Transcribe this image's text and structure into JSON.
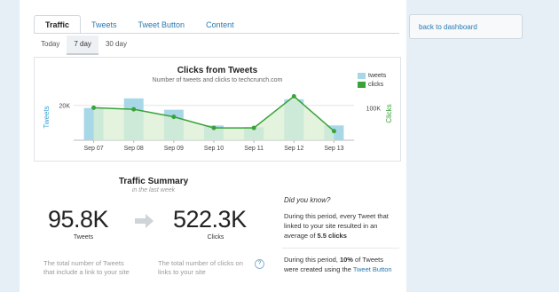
{
  "tabs": [
    {
      "label": "Traffic",
      "active": true
    },
    {
      "label": "Tweets",
      "active": false
    },
    {
      "label": "Tweet Button",
      "active": false
    },
    {
      "label": "Content",
      "active": false
    }
  ],
  "range_tabs": [
    {
      "label": "Today",
      "active": false
    },
    {
      "label": "7 day",
      "active": true
    },
    {
      "label": "30 day",
      "active": false
    }
  ],
  "back_button": "back to dashboard",
  "chart_data": {
    "type": "bar",
    "title": "Clicks from Tweets",
    "subtitle": "Number of tweets and clicks to techcrunch.com",
    "categories": [
      "Sep 07",
      "Sep 08",
      "Sep 09",
      "Sep 10",
      "Sep 11",
      "Sep 12",
      "Sep 13"
    ],
    "series": [
      {
        "name": "tweets",
        "type": "bar",
        "values": [
          18500,
          24000,
          17500,
          8500,
          7500,
          23500,
          8500
        ],
        "color": "#a8d8e8"
      },
      {
        "name": "clicks",
        "type": "area",
        "values": [
          100000,
          95000,
          72000,
          38000,
          38000,
          135000,
          28000
        ],
        "color": "#3aa23a"
      }
    ],
    "ylabel_left": "Tweets",
    "ylabel_right": "Clicks",
    "yticks_left": [
      "20K"
    ],
    "yticks_right": [
      "100K"
    ],
    "ylim_left": [
      0,
      28000
    ],
    "ylim_right": [
      0,
      150000
    ],
    "legend_position": "top-right"
  },
  "summary": {
    "title": "Traffic Summary",
    "subtitle": "in the last week",
    "tweets_value": "95.8K",
    "tweets_label": "Tweets",
    "clicks_value": "522.3K",
    "clicks_label": "Clicks",
    "tweets_desc_1": "The total number of Tweets",
    "tweets_desc_2": "that include a link to your site",
    "clicks_desc_1": "The total number of clicks on",
    "clicks_desc_2": "links to your site",
    "help_icon": "?"
  },
  "did_you_know": {
    "title": "Did you know?",
    "p1_line1": "During this period, every Tweet that",
    "p1_line2": "linked to your site resulted in an",
    "p1_line3_pre": "average of ",
    "p1_line3_bold": "5.5 clicks",
    "p2_line1_pre": "During this period, ",
    "p2_line1_bold": "10%",
    "p2_line1_post": " of Tweets",
    "p2_line2_pre": "were created using the ",
    "p2_line2_link": "Tweet Button"
  },
  "colors": {
    "accent": "#2a7ab0",
    "tweets_bar": "#a8d8e8",
    "clicks_line": "#3aa23a",
    "clicks_fill": "#d9efd2"
  }
}
